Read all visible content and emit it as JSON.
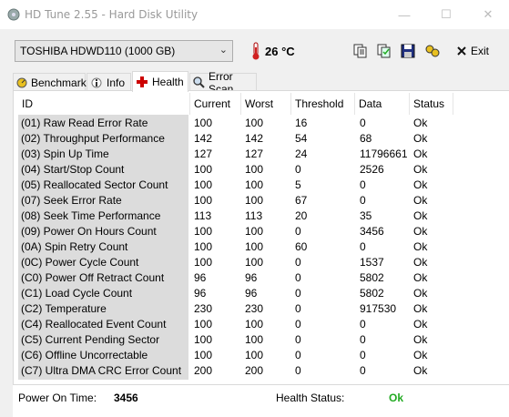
{
  "window": {
    "title": "HD Tune 2.55 - Hard Disk Utility",
    "minimize_glyph": "—",
    "maximize_glyph": "☐",
    "close_glyph": "✕"
  },
  "toolbar": {
    "drive": "TOSHIBA HDWD110 (1000 GB)",
    "temperature": "26 °C",
    "exit_label": "Exit"
  },
  "tabs": [
    {
      "label": "Benchmark",
      "icon": "benchmark-icon"
    },
    {
      "label": "Info",
      "icon": "info-icon"
    },
    {
      "label": "Health",
      "icon": "health-icon"
    },
    {
      "label": "Error Scan",
      "icon": "error-scan-icon"
    }
  ],
  "table": {
    "headers": [
      "ID",
      "Current",
      "Worst",
      "Threshold",
      "Data",
      "Status"
    ],
    "rows": [
      {
        "id": "(01) Raw Read Error Rate",
        "current": "100",
        "worst": "100",
        "threshold": "16",
        "data": "0",
        "status": "Ok"
      },
      {
        "id": "(02) Throughput Performance",
        "current": "142",
        "worst": "142",
        "threshold": "54",
        "data": "68",
        "status": "Ok"
      },
      {
        "id": "(03) Spin Up Time",
        "current": "127",
        "worst": "127",
        "threshold": "24",
        "data": "11796661",
        "status": "Ok"
      },
      {
        "id": "(04) Start/Stop Count",
        "current": "100",
        "worst": "100",
        "threshold": "0",
        "data": "2526",
        "status": "Ok"
      },
      {
        "id": "(05) Reallocated Sector Count",
        "current": "100",
        "worst": "100",
        "threshold": "5",
        "data": "0",
        "status": "Ok"
      },
      {
        "id": "(07) Seek Error Rate",
        "current": "100",
        "worst": "100",
        "threshold": "67",
        "data": "0",
        "status": "Ok"
      },
      {
        "id": "(08) Seek Time Performance",
        "current": "113",
        "worst": "113",
        "threshold": "20",
        "data": "35",
        "status": "Ok"
      },
      {
        "id": "(09) Power On Hours Count",
        "current": "100",
        "worst": "100",
        "threshold": "0",
        "data": "3456",
        "status": "Ok"
      },
      {
        "id": "(0A) Spin Retry Count",
        "current": "100",
        "worst": "100",
        "threshold": "60",
        "data": "0",
        "status": "Ok"
      },
      {
        "id": "(0C) Power Cycle Count",
        "current": "100",
        "worst": "100",
        "threshold": "0",
        "data": "1537",
        "status": "Ok"
      },
      {
        "id": "(C0) Power Off Retract Count",
        "current": "96",
        "worst": "96",
        "threshold": "0",
        "data": "5802",
        "status": "Ok"
      },
      {
        "id": "(C1) Load Cycle Count",
        "current": "96",
        "worst": "96",
        "threshold": "0",
        "data": "5802",
        "status": "Ok"
      },
      {
        "id": "(C2) Temperature",
        "current": "230",
        "worst": "230",
        "threshold": "0",
        "data": "917530",
        "status": "Ok"
      },
      {
        "id": "(C4) Reallocated Event Count",
        "current": "100",
        "worst": "100",
        "threshold": "0",
        "data": "0",
        "status": "Ok"
      },
      {
        "id": "(C5) Current Pending Sector",
        "current": "100",
        "worst": "100",
        "threshold": "0",
        "data": "0",
        "status": "Ok"
      },
      {
        "id": "(C6) Offline Uncorrectable",
        "current": "100",
        "worst": "100",
        "threshold": "0",
        "data": "0",
        "status": "Ok"
      },
      {
        "id": "(C7) Ultra DMA CRC Error Count",
        "current": "200",
        "worst": "200",
        "threshold": "0",
        "data": "0",
        "status": "Ok"
      }
    ]
  },
  "footer": {
    "power_on_label": "Power On Time:",
    "power_on_value": "3456",
    "health_label": "Health Status:",
    "health_value": "Ok"
  },
  "colors": {
    "health_ok": "#22aa22",
    "temperature_icon": "#d02020",
    "health_tab_icon": "#cc0000"
  }
}
